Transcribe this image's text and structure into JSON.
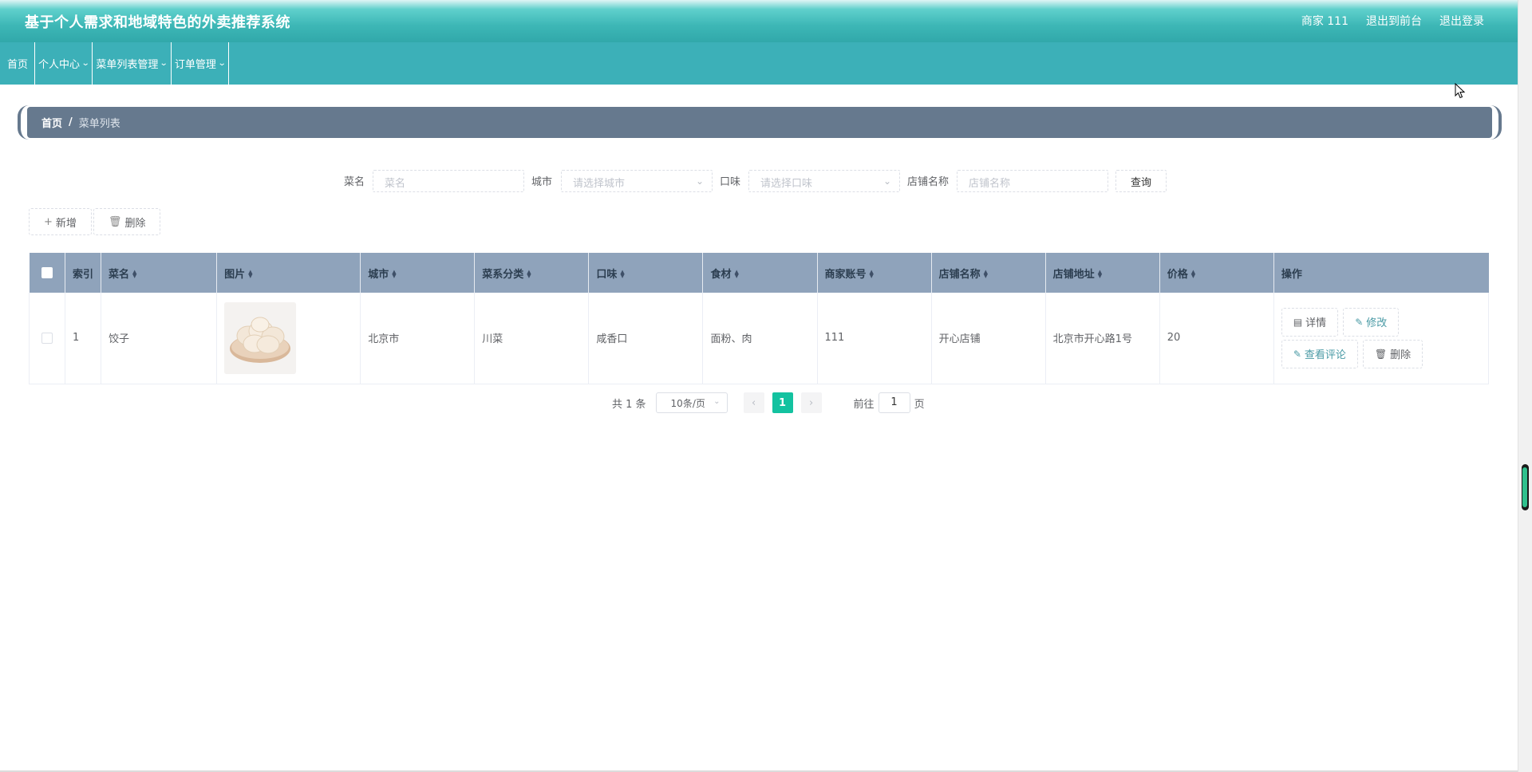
{
  "header": {
    "title": "基于个人需求和地域特色的外卖推荐系统",
    "user_label": "商家 111",
    "to_front": "退出到前台",
    "logout": "退出登录"
  },
  "nav": {
    "items": [
      {
        "label": "首页",
        "dropdown": false
      },
      {
        "label": "个人中心",
        "dropdown": true
      },
      {
        "label": "菜单列表管理",
        "dropdown": true
      },
      {
        "label": "订单管理",
        "dropdown": true
      }
    ]
  },
  "breadcrumb": {
    "home": "首页",
    "separator": "/",
    "current": "菜单列表"
  },
  "search": {
    "dish_label": "菜名",
    "dish_placeholder": "菜名",
    "city_label": "城市",
    "city_placeholder": "请选择城市",
    "taste_label": "口味",
    "taste_placeholder": "请选择口味",
    "shop_label": "店铺名称",
    "shop_placeholder": "店铺名称",
    "query_button": "查询"
  },
  "actions": {
    "add": "新增",
    "delete": "删除"
  },
  "table": {
    "columns": [
      "索引",
      "菜名",
      "图片",
      "城市",
      "菜系分类",
      "口味",
      "食材",
      "商家账号",
      "店铺名称",
      "店铺地址",
      "价格",
      "操作"
    ],
    "sortable": [
      false,
      true,
      true,
      true,
      true,
      true,
      true,
      true,
      true,
      true,
      true,
      false
    ],
    "rows": [
      {
        "index": "1",
        "dish": "饺子",
        "city": "北京市",
        "cuisine": "川菜",
        "taste": "咸香口",
        "ingredients": "面粉、肉",
        "merchant": "111",
        "shop": "开心店铺",
        "address": "北京市开心路1号",
        "price": "20",
        "ops": {
          "detail": "详情",
          "edit": "修改",
          "comments": "查看评论",
          "delete": "删除"
        }
      }
    ]
  },
  "pagination": {
    "total": "共 1 条",
    "page_size": "10条/页",
    "current_page": "1",
    "goto_label": "前往",
    "goto_value": "1",
    "page_unit": "页"
  },
  "colors": {
    "header": "#3db7b6",
    "nav": "#3cb0b8",
    "breadcrumb": "#66798e",
    "table_header": "#8fa3bb",
    "active_page": "#13c2a0"
  }
}
